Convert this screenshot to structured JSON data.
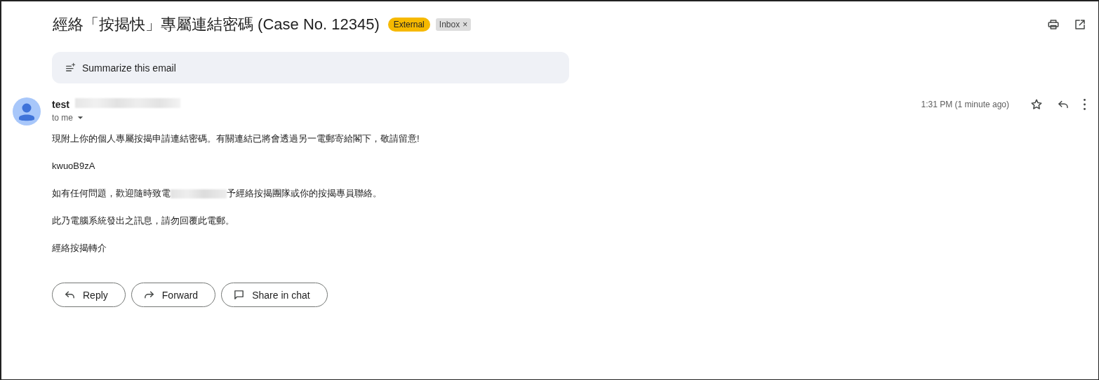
{
  "subject": "經絡「按揭快」專屬連結密碼 (Case No. 12345)",
  "labels": [
    {
      "kind": "category",
      "text": "External"
    },
    {
      "kind": "removable",
      "text": "Inbox",
      "remove": "×"
    }
  ],
  "summarize": {
    "label": "Summarize this email"
  },
  "message": {
    "sender": "test",
    "sender_address_redacted": true,
    "recipient": "to me",
    "time": "1:31 PM (1 minute ago)",
    "starred": false,
    "body": [
      {
        "kind": "text",
        "text": "現附上你的個人專屬按揭申請連結密碼。有關連結已將會透過另一電郵寄給閣下，敬請留意!"
      },
      {
        "kind": "text",
        "text": "kwuoB9zA"
      },
      {
        "kind": "redacted",
        "before": "如有任何問題，歡迎隨時致電",
        "after": "予經絡按揭團隊或你的按揭專員聯絡。"
      },
      {
        "kind": "text",
        "text": "此乃電腦系統發出之訊息，請勿回覆此電郵。"
      },
      {
        "kind": "text",
        "text": "經絡按揭轉介"
      }
    ]
  },
  "actions": [
    {
      "kind": "reply",
      "label": "Reply"
    },
    {
      "kind": "forward",
      "label": "Forward"
    },
    {
      "kind": "chat",
      "label": "Share in chat"
    }
  ]
}
